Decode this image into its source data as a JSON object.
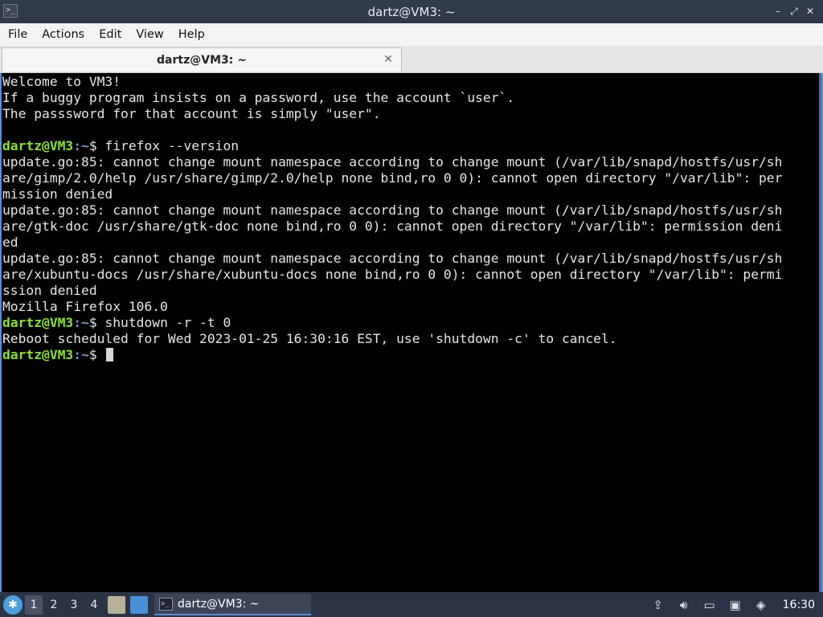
{
  "window": {
    "title": "dartz@VM3: ~",
    "controls": {
      "minimize": "–",
      "maximize": "⤢",
      "close": "✕"
    }
  },
  "menu": [
    "File",
    "Actions",
    "Edit",
    "View",
    "Help"
  ],
  "tab": {
    "label": "dartz@VM3: ~",
    "close": "✕"
  },
  "terminal": {
    "prompt": {
      "user": "dartz@VM3",
      "path": ":~",
      "symbol": "$ "
    },
    "lines": [
      {
        "type": "text",
        "text": "Welcome to VM3!"
      },
      {
        "type": "text",
        "text": "If a buggy program insists on a password, use the account `user`."
      },
      {
        "type": "text",
        "text": "The passsword for that account is simply \"user\"."
      },
      {
        "type": "text",
        "text": ""
      },
      {
        "type": "prompt",
        "cmd": "firefox --version"
      },
      {
        "type": "text",
        "text": "update.go:85: cannot change mount namespace according to change mount (/var/lib/snapd/hostfs/usr/sh"
      },
      {
        "type": "text",
        "text": "are/gimp/2.0/help /usr/share/gimp/2.0/help none bind,ro 0 0): cannot open directory \"/var/lib\": per"
      },
      {
        "type": "text",
        "text": "mission denied"
      },
      {
        "type": "text",
        "text": "update.go:85: cannot change mount namespace according to change mount (/var/lib/snapd/hostfs/usr/sh"
      },
      {
        "type": "text",
        "text": "are/gtk-doc /usr/share/gtk-doc none bind,ro 0 0): cannot open directory \"/var/lib\": permission deni"
      },
      {
        "type": "text",
        "text": "ed"
      },
      {
        "type": "text",
        "text": "update.go:85: cannot change mount namespace according to change mount (/var/lib/snapd/hostfs/usr/sh"
      },
      {
        "type": "text",
        "text": "are/xubuntu-docs /usr/share/xubuntu-docs none bind,ro 0 0): cannot open directory \"/var/lib\": permi"
      },
      {
        "type": "text",
        "text": "ssion denied"
      },
      {
        "type": "text",
        "text": "Mozilla Firefox 106.0"
      },
      {
        "type": "prompt",
        "cmd": "shutdown -r -t 0"
      },
      {
        "type": "text",
        "text": "Reboot scheduled for Wed 2023-01-25 16:30:16 EST, use 'shutdown -c' to cancel."
      },
      {
        "type": "prompt",
        "cmd": "",
        "cursor": true
      }
    ]
  },
  "taskbar": {
    "workspaces": [
      "1",
      "2",
      "3",
      "4"
    ],
    "active_workspace": "1",
    "task_label": "dartz@VM3: ~",
    "clock": "16:30"
  },
  "colors": {
    "prompt_user": "#8ae234",
    "prompt_path": "#729fcf",
    "panel": "#2b3446",
    "accent": "#5a8fd0"
  }
}
